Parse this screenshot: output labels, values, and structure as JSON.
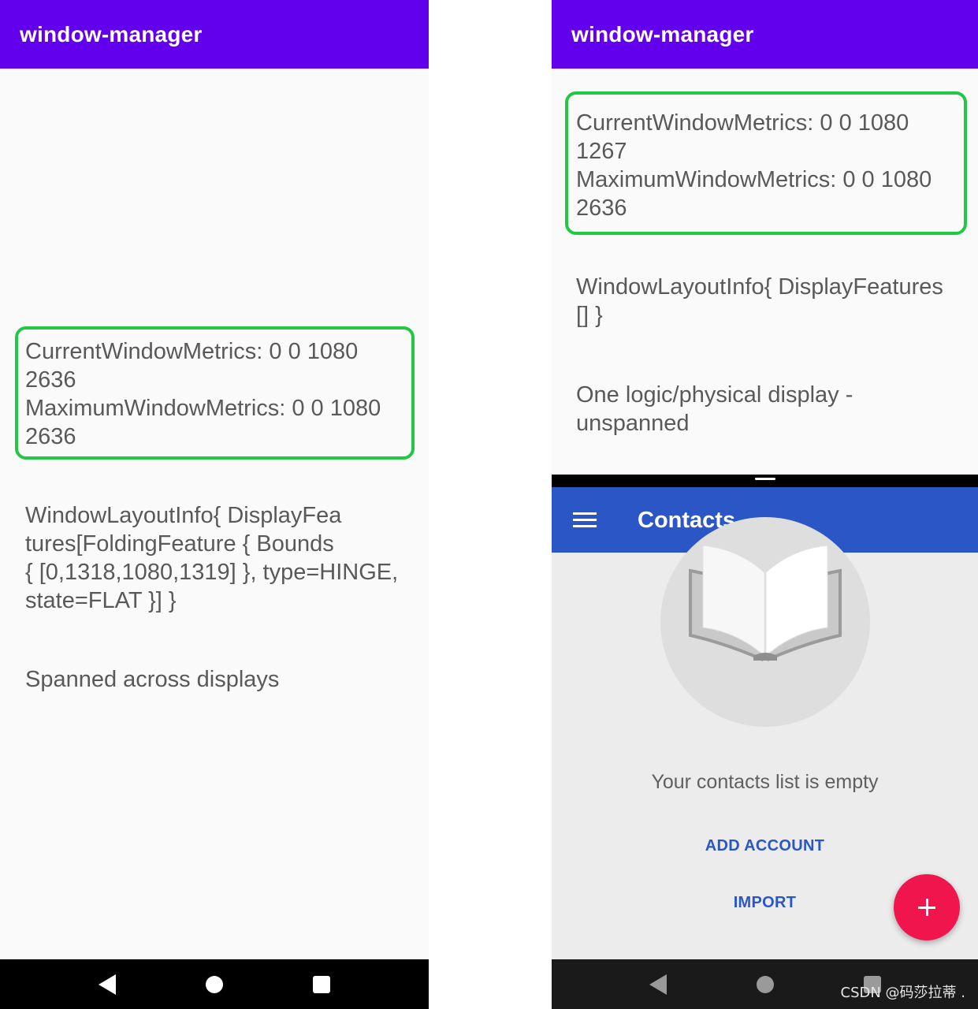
{
  "left_screen": {
    "app_title": "window-manager",
    "metrics_text": "CurrentWindowMetrics: 0 0 1080\n2636\nMaximumWindowMetrics: 0 0 1080\n2636",
    "layout_info_text": "WindowLayoutInfo{ DisplayFea\ntures[FoldingFeature { Bounds\n{ [0,1318,1080,1319] }, type=HINGE,\nstate=FLAT }] }",
    "display_status": "Spanned across displays"
  },
  "right_screen": {
    "app_title": "window-manager",
    "metrics_text": "CurrentWindowMetrics: 0 0 1080\n1267\nMaximumWindowMetrics: 0 0 1080\n2636",
    "layout_info_text": "WindowLayoutInfo{ DisplayFeatures\n[] }",
    "display_status": "One logic/physical display -\nunspanned"
  },
  "contacts": {
    "title": "Contacts",
    "empty_message": "Your contacts list is empty",
    "add_account_label": "ADD ACCOUNT",
    "import_label": "IMPORT",
    "fab_icon": "plus-icon",
    "menu_icon": "hamburger-menu-icon"
  },
  "watermark": "CSDN @码莎拉蒂 .",
  "colors": {
    "app_bar": "#6200ee",
    "highlight_box": "#22c744",
    "contacts_bar": "#2a56c6",
    "fab": "#f0154d",
    "link": "#2a56c6"
  }
}
